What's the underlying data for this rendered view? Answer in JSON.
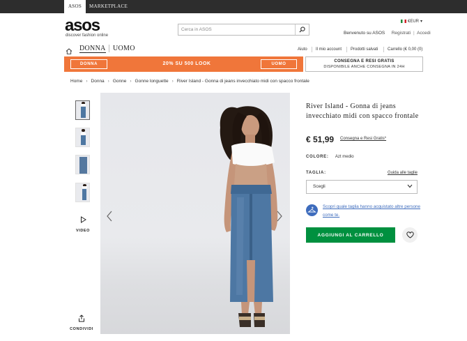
{
  "topbar": {
    "asos": "ASOS",
    "marketplace": "MARKETPLACE"
  },
  "header": {
    "logo": "asos",
    "tagline": "discover fashion online",
    "search_placeholder": "Cerca in ASOS",
    "currency": "€EUR",
    "welcome": "Benvenuto su ASOS",
    "register": "Registrati",
    "login": "Accedi"
  },
  "nav": {
    "donna": "DONNA",
    "uomo": "UOMO",
    "aiuto": "Aiuto",
    "account": "Il mio account",
    "saved": "Prodotti salvati",
    "cart": "Carrello (€ 0,00 (0)"
  },
  "promo": {
    "left_btn": "DONNA",
    "text": "20% SU 500 LOOK",
    "right_btn": "UOMO",
    "ship_line1": "CONSEGNA E RESI GRATIS",
    "ship_line2": "DISPONIBILE ANCHE CONSEGNA IN 24H"
  },
  "breadcrumb": [
    "Home",
    "Donna",
    "Gonne",
    "Gonne longuette",
    "River Island - Gonna di jeans invecchiato midi con spacco frontale"
  ],
  "gallery": {
    "video": "VIDEO",
    "share": "CONDIVIDI"
  },
  "product": {
    "title": "River Island - Gonna di jeans invecchiato midi con spacco frontale",
    "price": "€ 51,99",
    "price_link": "Consegna e Resi Gratis*",
    "color_label": "COLORE:",
    "color_value": "Azt medio",
    "size_label": "TAGLIA:",
    "size_guide": "Guida alle taglie",
    "size_select": "Scegli",
    "fit_text": "Scopri quale taglia hanno acquistato altre persone come te.",
    "add_to_cart": "AGGIUNGI AL CARRELLO"
  },
  "colors": {
    "orange": "#f0763a",
    "green": "#00903f",
    "blue": "#3e6cbd",
    "dark": "#2d2d2d"
  }
}
